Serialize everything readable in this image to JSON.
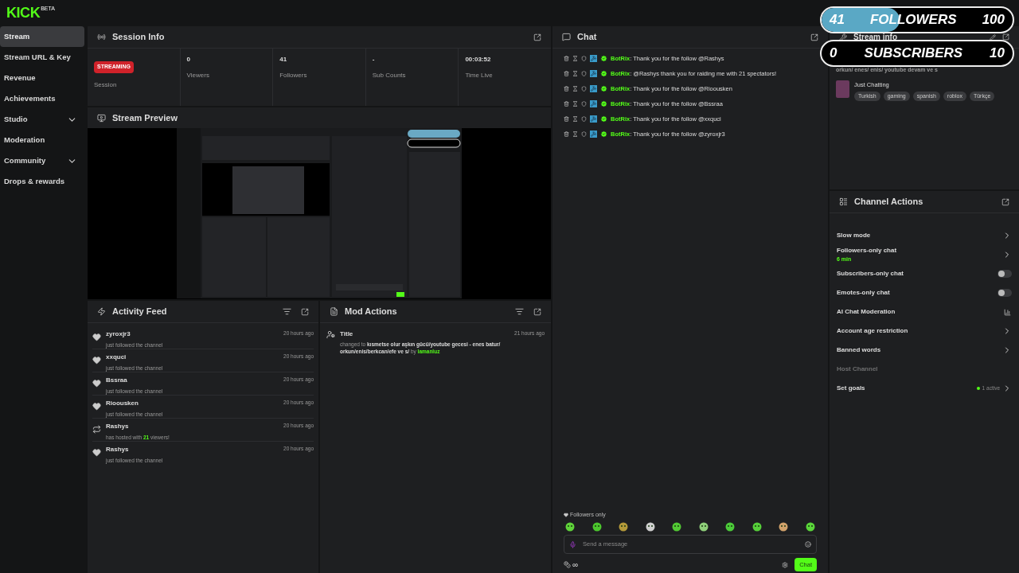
{
  "logo": {
    "text": "KICK",
    "tag": "BETA"
  },
  "sidebar": {
    "items": [
      {
        "label": "Stream",
        "selected": true,
        "expandable": false
      },
      {
        "label": "Stream URL & Key",
        "selected": false,
        "expandable": false
      },
      {
        "label": "Revenue",
        "selected": false,
        "expandable": false
      },
      {
        "label": "Achievements",
        "selected": false,
        "expandable": false
      },
      {
        "label": "Studio",
        "selected": false,
        "expandable": true
      },
      {
        "label": "Moderation",
        "selected": false,
        "expandable": false
      },
      {
        "label": "Community",
        "selected": false,
        "expandable": true
      },
      {
        "label": "Drops & rewards",
        "selected": false,
        "expandable": false
      }
    ]
  },
  "session_info": {
    "title": "Session Info",
    "status_badge": "STREAMING",
    "stats": [
      {
        "label": "Session"
      },
      {
        "value": "0",
        "label": "Viewers"
      },
      {
        "value": "41",
        "label": "Followers"
      },
      {
        "value": "-",
        "label": "Sub Counts"
      },
      {
        "value": "00:03:52",
        "label": "Time Live"
      }
    ]
  },
  "stream_preview": {
    "title": "Stream Preview"
  },
  "activity_feed": {
    "title": "Activity Feed",
    "items": [
      {
        "kind": "follow",
        "name": "zyroxjr3",
        "text": "just followed the channel",
        "time": "20 hours ago"
      },
      {
        "kind": "follow",
        "name": "xxquci",
        "text": "just followed the channel",
        "time": "20 hours ago"
      },
      {
        "kind": "follow",
        "name": "Bssraa",
        "text": "just followed the channel",
        "time": "20 hours ago"
      },
      {
        "kind": "follow",
        "name": "Rioousken",
        "text": "just followed the channel",
        "time": "20 hours ago"
      },
      {
        "kind": "host",
        "name": "Rashys",
        "text": "has hosted with",
        "count": "21",
        "text_after": "viewers!",
        "time": "20 hours ago"
      },
      {
        "kind": "follow",
        "name": "Rashys",
        "text": "just followed the channel",
        "time": "20 hours ago"
      }
    ]
  },
  "mod_actions": {
    "title": "Mod Actions",
    "items": [
      {
        "title": "Title",
        "prefix": "changed to",
        "value": "kısmetse olur aşkın gücü/youtube gecesi - enes batur/ orkun/enis/berkcan/efe ve s/",
        "by": "by",
        "user": "lamanluz",
        "time": "21 hours ago"
      }
    ]
  },
  "chat": {
    "title": "Chat",
    "messages": [
      {
        "user": "BotRix",
        "text": ": Thank you for the follow @Rashys"
      },
      {
        "user": "BotRix",
        "text": ": @Rashys thank you for raiding me with 21 spectators!"
      },
      {
        "user": "BotRix",
        "text": ": Thank you for the follow @Rioousken"
      },
      {
        "user": "BotRix",
        "text": ": Thank you for the follow @Bssraa"
      },
      {
        "user": "BotRix",
        "text": ": Thank you for the follow @xxquci"
      },
      {
        "user": "BotRix",
        "text": ": Thank you for the follow @zyroxjr3"
      }
    ],
    "mode_label": "Followers only",
    "input": {
      "placeholder": "Send a message"
    },
    "points": "∞",
    "send_button": "Chat"
  },
  "stream_info": {
    "title": "Stream info",
    "stream_title": "orkun/ enes/ enis/ youtube devam ve s",
    "category": "Just Chatting",
    "tags": [
      "Turkish",
      "gaming",
      "spanish",
      "roblox",
      "Türkçe"
    ]
  },
  "channel_actions": {
    "title": "Channel Actions",
    "items": [
      {
        "kind": "arrow",
        "label": "Slow mode"
      },
      {
        "kind": "arrow",
        "label": "Followers-only chat",
        "sub": "6 min"
      },
      {
        "kind": "toggle",
        "label": "Subscribers-only chat",
        "on": false
      },
      {
        "kind": "toggle",
        "label": "Emotes-only chat",
        "on": false
      },
      {
        "kind": "external",
        "label": "AI Chat Moderation"
      },
      {
        "kind": "arrow",
        "label": "Account age restriction"
      },
      {
        "kind": "arrow",
        "label": "Banned words"
      },
      {
        "kind": "disabled",
        "label": "Host Channel"
      },
      {
        "kind": "arrow",
        "label": "Set goals",
        "badge": "1 active"
      }
    ]
  },
  "goal_overlays": [
    {
      "current": "41",
      "label": "FOLLOWERS",
      "target": "100",
      "level": 0.41
    },
    {
      "current": "0",
      "label": "SUBSCRIBERS",
      "target": "10"
    }
  ]
}
